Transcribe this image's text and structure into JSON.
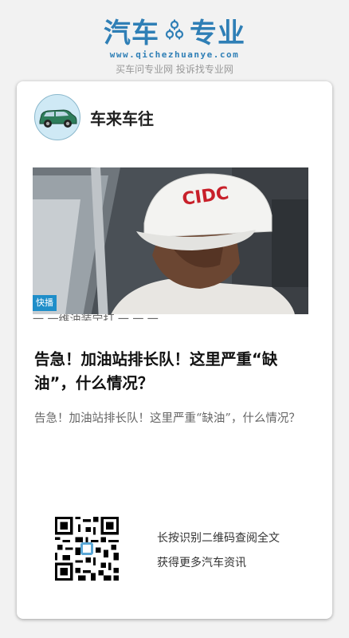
{
  "header": {
    "logo_left": "汽车",
    "logo_right": "专业",
    "logo_url": "www.qichezhuanye.com",
    "tagline": "买车问专业网 投诉找专业网",
    "brand_color": "#2f7fb6"
  },
  "author": {
    "name": "车来车往",
    "avatar_icon": "green-car-icon"
  },
  "photo": {
    "description_icon": "news-photo",
    "cap_text": "CIDC",
    "live_badge": "快播",
    "subtitle_fragment": "一 一维油装宁打 一 一 一"
  },
  "article": {
    "title": "告急！加油站排长队！这里严重“缺油”，什么情况？",
    "summary": "告急！加油站排长队！这里严重“缺油”，什么情况？"
  },
  "qr": {
    "icon": "qr-code-icon",
    "line1": "长按识别二维码查阅全文",
    "line2": "获得更多汽车资讯"
  }
}
